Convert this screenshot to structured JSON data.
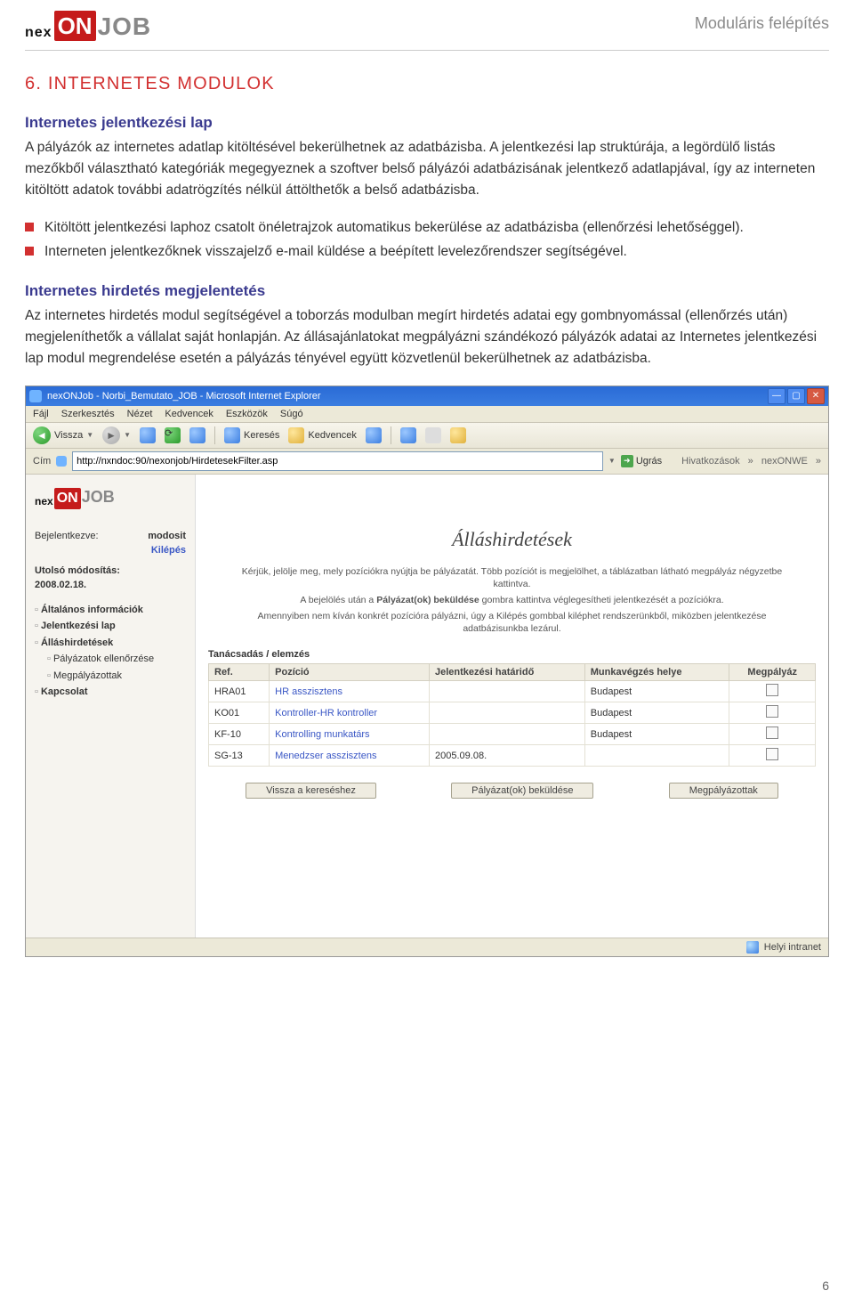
{
  "header": {
    "logo_part1": "nex",
    "logo_part2": "ON",
    "logo_part3": "JOB",
    "corner_title": "Moduláris felépítés"
  },
  "section": {
    "title": "6. INTERNETES MODULOK"
  },
  "subsection1": {
    "title": "Internetes jelentkezési lap",
    "para1": "A pályázók az internetes adatlap kitöltésével bekerülhetnek az adatbázisba. A jelentkezési lap struktúrája, a legördülő listás mezőkből választható kategóriák megegyeznek a szoftver belső pályázói adatbázisának jelentkező adatlapjával, így az interneten kitöltött adatok további adatrögzítés nélkül áttölthetők a belső adatbázisba.",
    "bullets": [
      "Kitöltött jelentkezési laphoz csatolt önéletrajzok automatikus bekerülése az adatbázisba (ellenőrzési lehetőséggel).",
      "Interneten jelentkezőknek visszajelző e-mail küldése a beépített levelezőrendszer segítségével."
    ]
  },
  "subsection2": {
    "title": "Internetes hirdetés megjelentetés",
    "para": "Az internetes hirdetés modul segítségével a toborzás modulban megírt hirdetés adatai egy gombnyomással (ellenőrzés után) megjeleníthetők a vállalat saját honlapján. Az állásajánlatokat megpályázni szándékozó pályázók adatai az Internetes jelentkezési lap modul megrendelése esetén a pályázás tényével együtt közvetlenül bekerülhetnek az adatbázisba."
  },
  "screenshot": {
    "window_title": "nexONJob - Norbi_Bemutato_JOB - Microsoft Internet Explorer",
    "menubar": [
      "Fájl",
      "Szerkesztés",
      "Nézet",
      "Kedvencek",
      "Eszközök",
      "Súgó"
    ],
    "toolbar": {
      "back": "Vissza",
      "search": "Keresés",
      "favorites": "Kedvencek"
    },
    "address": {
      "label": "Cím",
      "value": "http://nxndoc:90/nexonjob/HirdetesekFilter.asp",
      "go": "Ugrás",
      "links_label": "Hivatkozások",
      "links_item": "nexONWE",
      "chevron": "»"
    },
    "left": {
      "logged_in_label": "Bejelentkezve:",
      "logged_in_value": "modosit",
      "logout": "Kilépés",
      "lastmod_label": "Utolsó módosítás:",
      "lastmod_value": "2008.02.18.",
      "nav": {
        "general": "Általános információk",
        "form": "Jelentkezési lap",
        "ads": "Álláshirdetések",
        "check": "Pályázatok ellenőrzése",
        "applied": "Megpályázottak",
        "contact": "Kapcsolat"
      }
    },
    "right": {
      "title": "Álláshirdetések",
      "info1": "Kérjük, jelölje meg, mely pozíciókra nyújtja be pályázatát. Több pozíciót is megjelölhet, a táblázatban látható megpályáz négyzetbe kattintva.",
      "info2_pre": "A bejelölés után a ",
      "info2_bold": "Pályázat(ok) beküldése",
      "info2_post": " gombra kattintva véglegesítheti jelentkezését a pozíciókra.",
      "info3": "Amennyiben nem kíván konkrét pozícióra pályázni, úgy a Kilépés gombbal kiléphet rendszerünkből, miközben jelentkezése adatbázisunkba lezárul.",
      "group_title": "Tanácsadás / elemzés",
      "cols": {
        "ref": "Ref.",
        "pos": "Pozíció",
        "deadline": "Jelentkezési határidő",
        "place": "Munkavégzés helye",
        "apply": "Megpályáz"
      },
      "rows": [
        {
          "ref": "HRA01",
          "pos": "HR asszisztens",
          "deadline": "",
          "place": "Budapest"
        },
        {
          "ref": "KO01",
          "pos": "Kontroller-HR kontroller",
          "deadline": "",
          "place": "Budapest"
        },
        {
          "ref": "KF-10",
          "pos": "Kontrolling munkatárs",
          "deadline": "",
          "place": "Budapest"
        },
        {
          "ref": "SG-13",
          "pos": "Menedzser asszisztens",
          "deadline": "2005.09.08.",
          "place": ""
        }
      ],
      "buttons": {
        "back": "Vissza a kereséshez",
        "send": "Pályázat(ok) beküldése",
        "applied": "Megpályázottak"
      }
    },
    "statusbar": "Helyi intranet"
  },
  "page_number": "6"
}
